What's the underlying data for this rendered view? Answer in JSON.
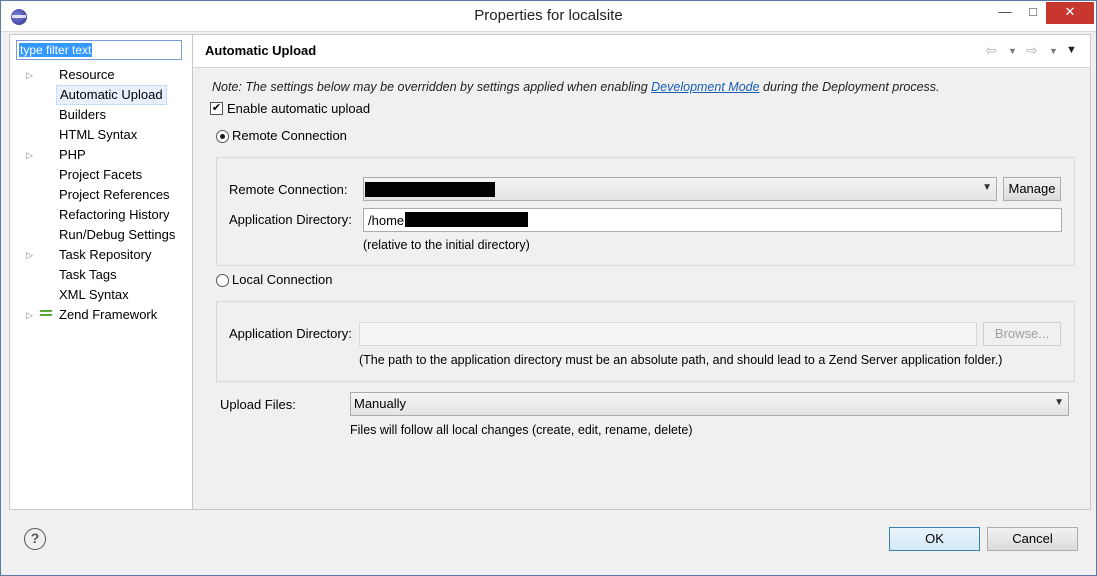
{
  "window": {
    "title": "Properties for localsite",
    "minimize": "—",
    "maximize": "□",
    "close": "✕"
  },
  "filter": {
    "placeholder": "type filter text"
  },
  "tree": [
    {
      "label": "Resource",
      "expandable": true
    },
    {
      "label": "Automatic Upload",
      "expandable": false,
      "selected": true
    },
    {
      "label": "Builders",
      "expandable": false
    },
    {
      "label": "HTML Syntax",
      "expandable": false
    },
    {
      "label": "PHP",
      "expandable": true
    },
    {
      "label": "Project Facets",
      "expandable": false
    },
    {
      "label": "Project References",
      "expandable": false
    },
    {
      "label": "Refactoring History",
      "expandable": false
    },
    {
      "label": "Run/Debug Settings",
      "expandable": false
    },
    {
      "label": "Task Repository",
      "expandable": true
    },
    {
      "label": "Task Tags",
      "expandable": false
    },
    {
      "label": "XML Syntax",
      "expandable": false
    },
    {
      "label": "Zend Framework",
      "expandable": true,
      "icon": "zend-framework-icon"
    }
  ],
  "header": {
    "title": "Automatic Upload",
    "nav_icons": [
      "back-arrow-icon",
      "dropdown-icon",
      "forward-arrow-icon",
      "dropdown-icon",
      "view-menu-icon"
    ]
  },
  "note": {
    "prefix": "Note: The settings below may be overridden by settings applied when enabling ",
    "link": "Development Mode",
    "suffix": " during the Deployment process."
  },
  "enable_upload": {
    "label": "Enable automatic upload",
    "checked": true
  },
  "remote": {
    "radio_label": "Remote Connection",
    "selected": true,
    "connection_label": "Remote Connection:",
    "manage_label": "Manage",
    "appdir_label": "Application Directory:",
    "appdir_value": "/home",
    "hint": "(relative to the initial directory)"
  },
  "local": {
    "radio_label": "Local Connection",
    "selected": false,
    "appdir_label": "Application Directory:",
    "browse_label": "Browse...",
    "hint": "(The path to the application directory must be an absolute path, and should lead to a Zend Server application folder.)"
  },
  "upload_files": {
    "label": "Upload Files:",
    "value": "Manually",
    "hint": "Files will follow all local changes (create, edit, rename, delete)"
  },
  "footer": {
    "help": "?",
    "ok_label": "OK",
    "cancel_label": "Cancel"
  },
  "colors": {
    "accent": "#3399ff",
    "link": "#1a5fb4",
    "close_button": "#c7372f"
  }
}
